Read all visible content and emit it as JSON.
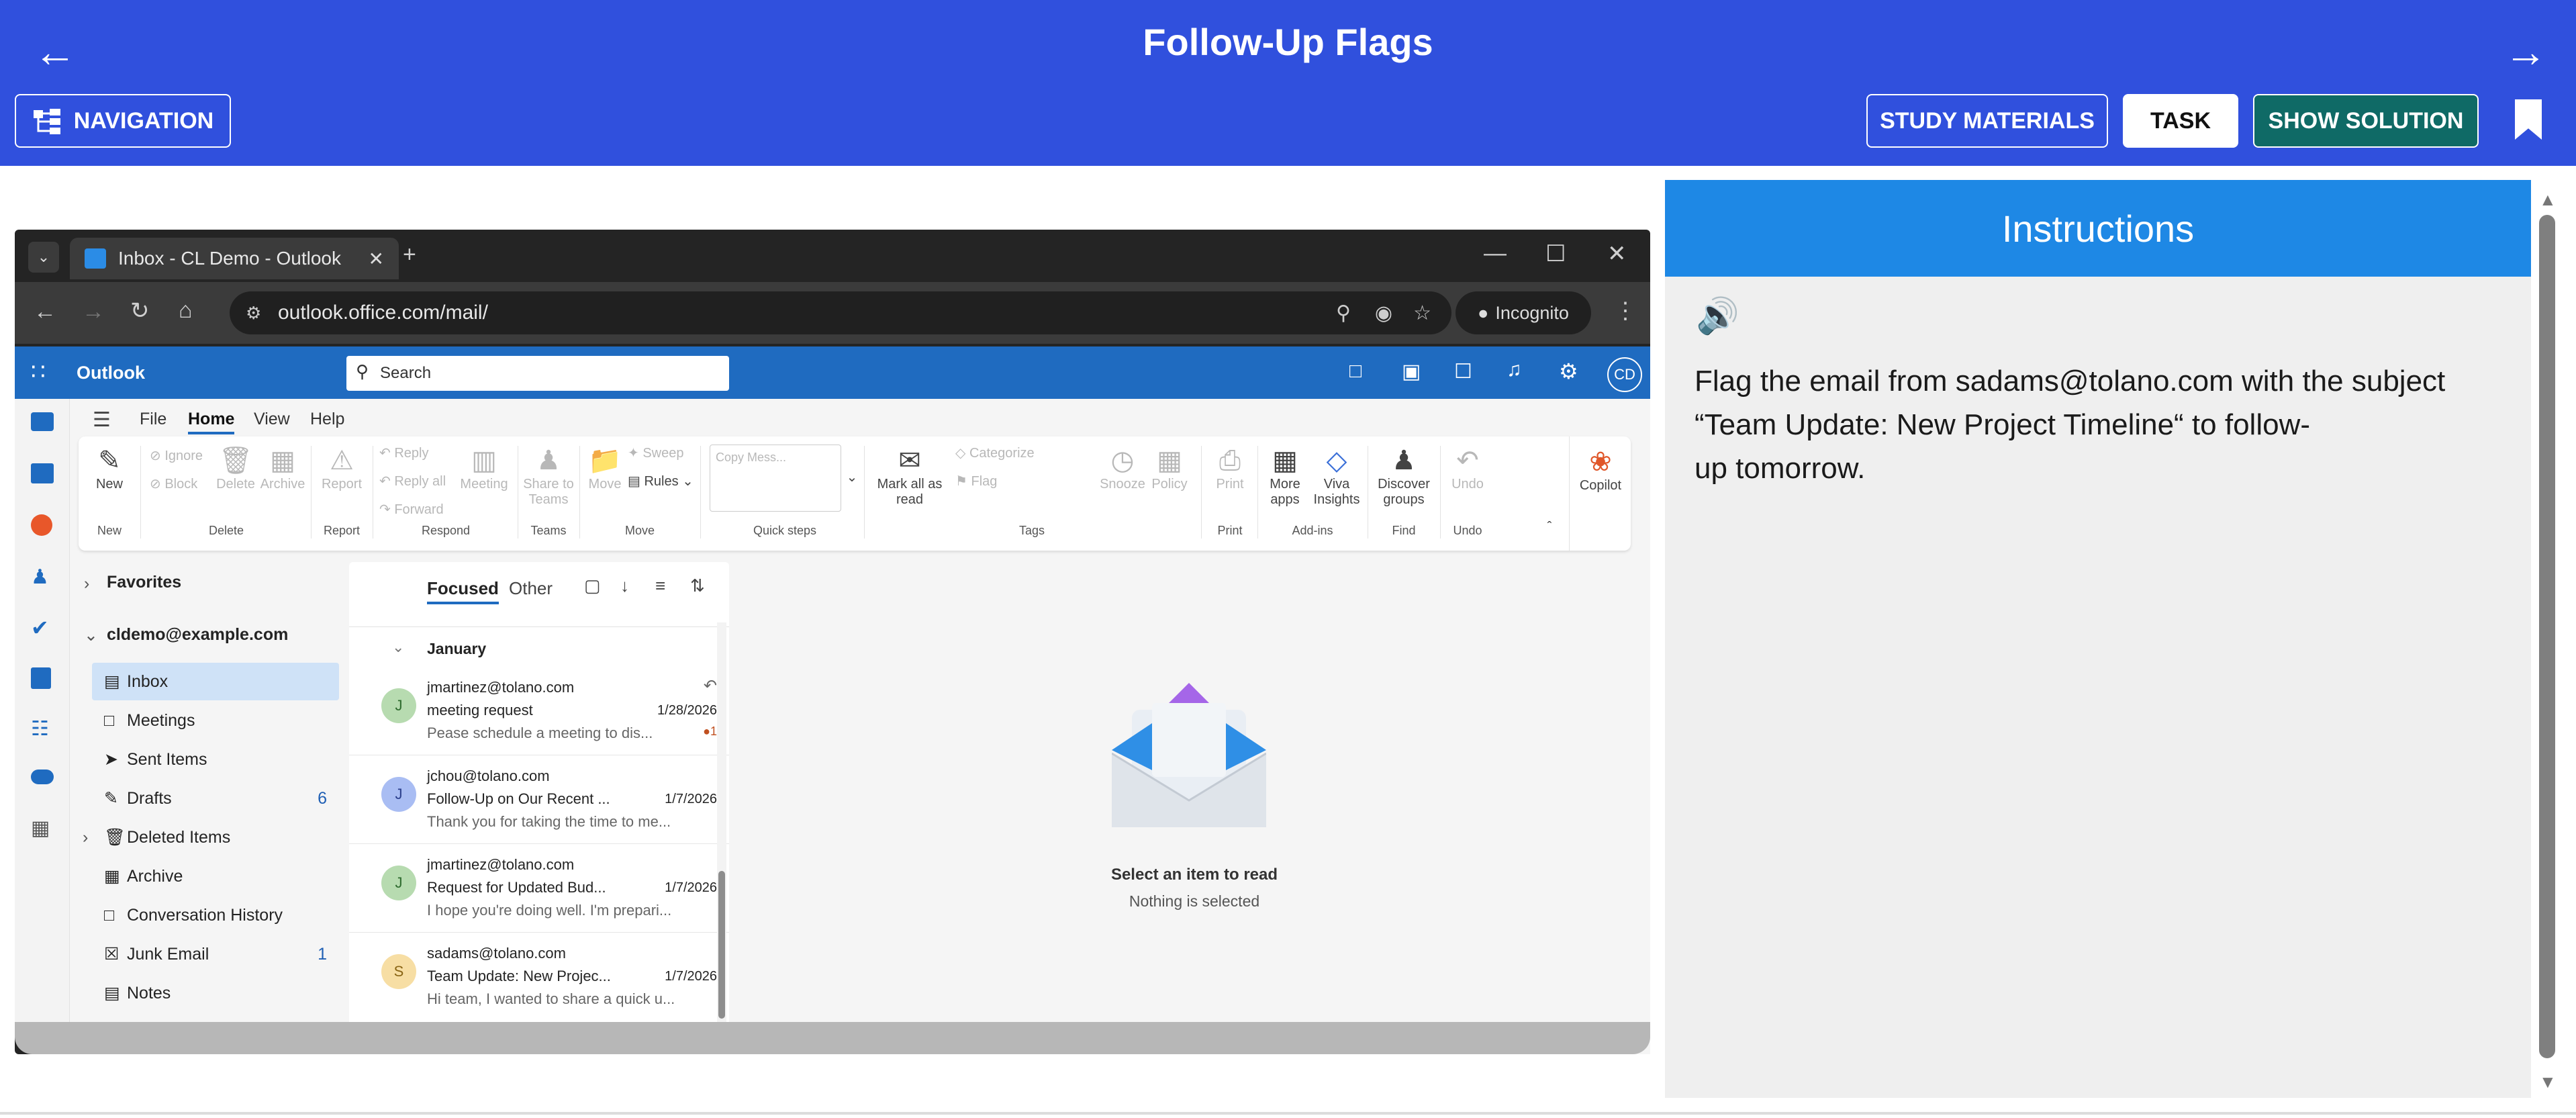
{
  "header": {
    "title": "Follow-Up Flags",
    "navigation_label": "NAVIGATION",
    "study_materials_label": "STUDY MATERIALS",
    "task_label": "TASK",
    "show_solution_label": "SHOW SOLUTION",
    "back_icon": "arrow-left-icon",
    "forward_icon": "arrow-right-icon"
  },
  "browser": {
    "tab_title": "Inbox - CL Demo - Outlook",
    "new_tab_symbol": "+",
    "url": "outlook.office.com/mail/",
    "incognito_label": "Incognito"
  },
  "outlook": {
    "app_name": "Outlook",
    "search_placeholder": "Search",
    "user_initials": "CD",
    "menu_tabs": [
      "File",
      "Home",
      "View",
      "Help"
    ],
    "ribbon": {
      "new_label": "New",
      "ignore_label": "Ignore",
      "block_label": "Block",
      "delete_label": "Delete",
      "archive_label": "Archive",
      "report_label": "Report",
      "reply_label": "Reply",
      "reply_all_label": "Reply all",
      "forward_label": "Forward",
      "meeting_label": "Meeting",
      "share_label": "Share to Teams",
      "move_label": "Move",
      "sweep_label": "Sweep",
      "rules_label": "Rules",
      "quickstep_label": "Copy Mess...",
      "mark_all_label": "Mark all as read",
      "categorize_label": "Categorize",
      "flag_label": "Flag",
      "snooze_label": "Snooze",
      "policy_label": "Policy",
      "print_label": "Print",
      "more_apps_label": "More apps",
      "viva_label": "Viva Insights",
      "discover_label": "Discover groups",
      "undo_label": "Undo",
      "copilot_label": "Copilot",
      "groups": {
        "new": "New",
        "delete": "Delete",
        "report": "Report",
        "respond": "Respond",
        "teams": "Teams",
        "move": "Move",
        "quicksteps": "Quick steps",
        "tags": "Tags",
        "print": "Print",
        "addins": "Add-ins",
        "find": "Find",
        "undo": "Undo"
      }
    },
    "folders": {
      "favorites": "Favorites",
      "account": "cldemo@example.com",
      "items": [
        {
          "name": "Inbox",
          "count": ""
        },
        {
          "name": "Meetings",
          "count": ""
        },
        {
          "name": "Sent Items",
          "count": ""
        },
        {
          "name": "Drafts",
          "count": "6"
        },
        {
          "name": "Deleted Items",
          "count": ""
        },
        {
          "name": "Archive",
          "count": ""
        },
        {
          "name": "Conversation History",
          "count": ""
        },
        {
          "name": "Junk Email",
          "count": "1"
        },
        {
          "name": "Notes",
          "count": ""
        }
      ]
    },
    "list": {
      "focused_label": "Focused",
      "other_label": "Other",
      "group_label": "January",
      "messages": [
        {
          "initial": "J",
          "sender": "jmartinez@tolano.com",
          "subject": "meeting request",
          "date": "1/28/2026",
          "preview": "Pease schedule a meeting to dis...",
          "badge": "1",
          "avatar_color": "#b7dbb0"
        },
        {
          "initial": "J",
          "sender": "jchou@tolano.com",
          "subject": "Follow-Up on Our Recent ...",
          "date": "1/7/2026",
          "preview": "Thank you for taking the time to me...",
          "badge": "",
          "avatar_color": "#a9bdf3"
        },
        {
          "initial": "J",
          "sender": "jmartinez@tolano.com",
          "subject": "Request for Updated Bud...",
          "date": "1/7/2026",
          "preview": "I hope you're doing well. I'm prepari...",
          "badge": "",
          "avatar_color": "#b7dbb0"
        },
        {
          "initial": "S",
          "sender": "sadams@tolano.com",
          "subject": "Team Update: New Projec...",
          "date": "1/7/2026",
          "preview": "Hi team, I wanted to share a quick u...",
          "badge": "",
          "avatar_color": "#f7dea4"
        }
      ]
    },
    "reading": {
      "title": "Select an item to read",
      "subtitle": "Nothing is selected"
    }
  },
  "instructions": {
    "title": "Instructions",
    "lines": [
      "Flag the email from sadams@tolano.com with the subject",
      "“Team Update: New Project Timeline“ to follow-",
      "up tomorrow."
    ]
  },
  "colors": {
    "header_bg": "#3050dd",
    "solution_bg": "#0f6a66",
    "instructions_bg": "#1e88e5",
    "outlook_blue": "#1f6bc0"
  }
}
